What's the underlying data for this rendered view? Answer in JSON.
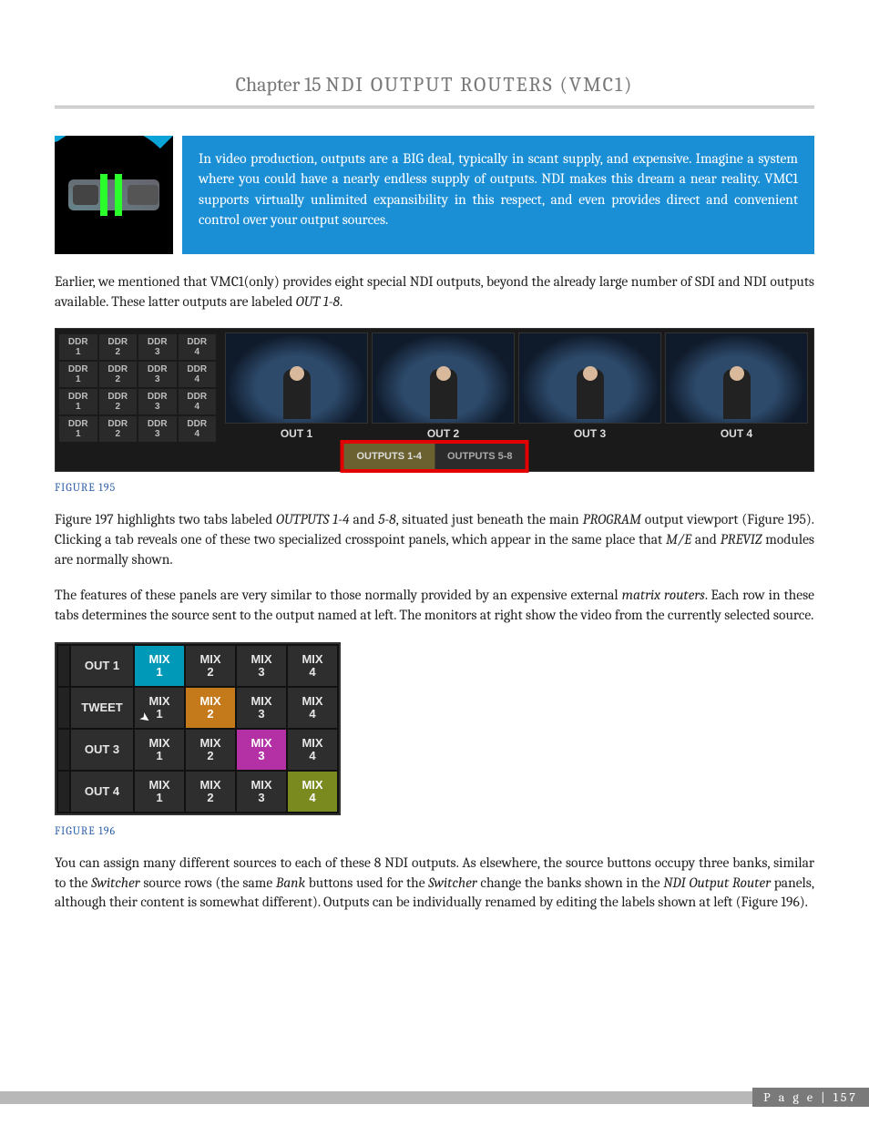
{
  "chapter": {
    "prefix": "Chapter 15",
    "title": "NDI OUTPUT ROUTERS (VMC1)"
  },
  "intro": "In video production, outputs are a BIG deal, typically in scant supply, and expensive. Imagine a system where you could have a nearly endless supply of outputs.  NDI makes this dream a near reality.  VMC1 supports virtually unlimited expansibility in this respect, and even provides direct and convenient control over your output sources.",
  "para1_a": "Earlier, we mentioned that VMC1(only) provides eight special NDI outputs, beyond the already large number of SDI and NDI outputs available.  These latter outputs are labeled ",
  "para1_b": "OUT 1-8",
  "para1_c": ".",
  "fig195": {
    "label": "FIGURE 195",
    "ddr_labels": [
      "DDR\n1",
      "DDR\n2",
      "DDR\n3",
      "DDR\n4"
    ],
    "outs": [
      "OUT 1",
      "OUT 2",
      "OUT 3",
      "OUT 4"
    ],
    "tabs": [
      "OUTPUTS 1-4",
      "OUTPUTS 5-8"
    ]
  },
  "para2_a": "Figure 197 highlights two tabs labeled ",
  "para2_b": "OUTPUTS 1-4",
  "para2_c": " and ",
  "para2_d": "5-8",
  "para2_e": ", situated just beneath the main ",
  "para2_f": "PROGRAM",
  "para2_g": " output viewport (Figure 195). Clicking a tab reveals one of these two specialized crosspoint panels, which appear in the same place that ",
  "para2_h": "M/E",
  "para2_i": " and ",
  "para2_j": "PREVIZ",
  "para2_k": " modules are normally shown.",
  "para3_a": "The features of these panels are very similar to those normally provided by an expensive external ",
  "para3_b": "matrix routers",
  "para3_c": ". Each row in these tabs determines the source sent to the output named at left. The monitors at right show the video from the currently selected source.",
  "fig196": {
    "label": "FIGURE 196",
    "rows": [
      "OUT 1",
      "TWEET",
      "OUT 3",
      "OUT 4"
    ],
    "cols": [
      "MIX\n1",
      "MIX\n2",
      "MIX\n3",
      "MIX\n4"
    ],
    "selected": {
      "0": 0,
      "1": 1,
      "2": 2,
      "3": 3
    },
    "sel_colors": [
      "cyan",
      "orange",
      "pink",
      "olive"
    ]
  },
  "para4_a": "You can assign many different sources to each of these 8 NDI outputs. As elsewhere, the source buttons occupy three banks, similar to the ",
  "para4_b": "Switcher",
  "para4_c": " source rows (the same ",
  "para4_d": "Bank",
  "para4_e": " buttons used for the ",
  "para4_f": "Switcher",
  "para4_g": " change the banks shown in the ",
  "para4_h": "NDI Output Router",
  "para4_i": " panels, although their content is somewhat different).  Outputs can be individually renamed by editing the labels shown at left (Figure 196).",
  "footer": {
    "label": "P a g e",
    "sep": "|",
    "num": "157"
  }
}
